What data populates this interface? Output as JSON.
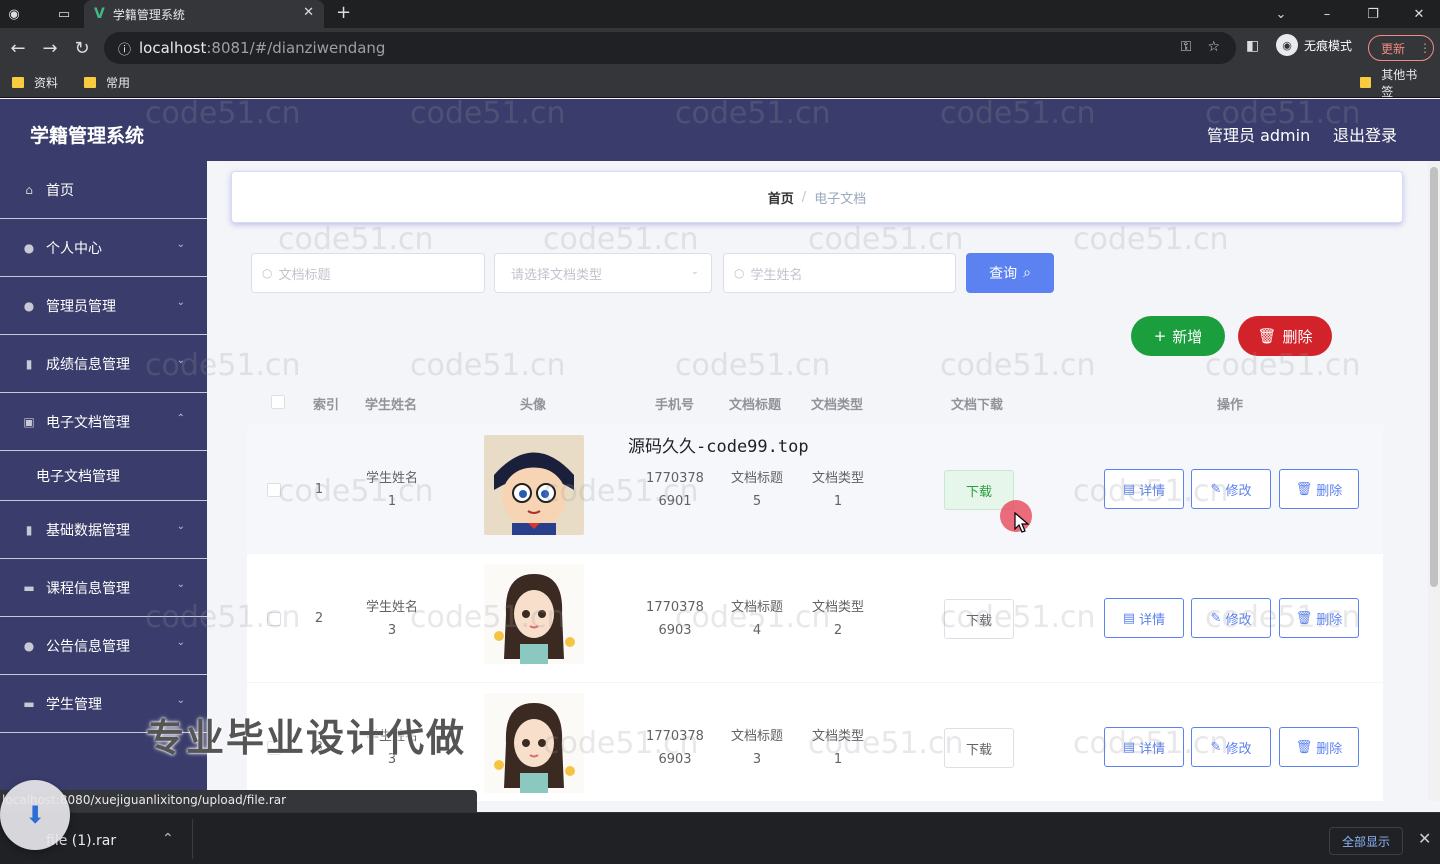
{
  "browser": {
    "tab_title": "学籍管理系统",
    "tab_logo": "V",
    "url_host": "localhost",
    "url_rest": ":8081/#/dianziwendang",
    "incognito_label": "无痕模式",
    "update_label": "更新",
    "bookmarks": [
      "资料",
      "常用"
    ],
    "other_bookmarks": "其他书签"
  },
  "header": {
    "brand": "学籍管理系统",
    "user": "管理员 admin",
    "logout": "退出登录"
  },
  "sidebar": {
    "items": [
      {
        "label": "首页",
        "icon": "home-icon"
      },
      {
        "label": "个人中心",
        "icon": "user-icon"
      },
      {
        "label": "管理员管理",
        "icon": "location-icon"
      },
      {
        "label": "成绩信息管理",
        "icon": "microphone-icon"
      },
      {
        "label": "电子文档管理",
        "icon": "delete-icon"
      },
      {
        "label": "电子文档管理",
        "icon": ""
      },
      {
        "label": "基础数据管理",
        "icon": "chart-icon"
      },
      {
        "label": "课程信息管理",
        "icon": "chat-icon"
      },
      {
        "label": "公告信息管理",
        "icon": "user-icon"
      },
      {
        "label": "学生管理",
        "icon": "briefcase-icon"
      }
    ]
  },
  "breadcrumb": {
    "home": "首页",
    "sep": "/",
    "current": "电子文档"
  },
  "search": {
    "title_placeholder": "文档标题",
    "type_placeholder": "请选择文档类型",
    "student_placeholder": "学生姓名",
    "query_label": "查询"
  },
  "actions": {
    "add_label": "新增",
    "delete_label": "删除"
  },
  "table": {
    "headers": [
      "索引",
      "学生姓名",
      "头像",
      "手机号",
      "文档标题",
      "文档类型",
      "文档下载",
      "操作"
    ],
    "rows": [
      {
        "index": "1",
        "name1": "学生姓名",
        "name2": "1",
        "phone1": "1770378",
        "phone2": "6901",
        "title1": "文档标题",
        "title2": "5",
        "type1": "文档类型",
        "type2": "1",
        "download": "下载"
      },
      {
        "index": "2",
        "name1": "学生姓名",
        "name2": "3",
        "phone1": "1770378",
        "phone2": "6903",
        "title1": "文档标题",
        "title2": "4",
        "type1": "文档类型",
        "type2": "2",
        "download": "下载"
      },
      {
        "index": "3",
        "name1": "学生姓名",
        "name2": "3",
        "phone1": "1770378",
        "phone2": "6903",
        "title1": "文档标题",
        "title2": "3",
        "type1": "文档类型",
        "type2": "1",
        "download": "下载"
      }
    ],
    "op_detail": "详情",
    "op_edit": "修改",
    "op_delete": "删除"
  },
  "overlay": {
    "source_text": "源码久久-code99.top",
    "ad_text": "专业毕业设计代做",
    "watermark": "code51.cn"
  },
  "status_url": "localhost:8080/xuejiguanlixitong/upload/file.rar",
  "downloads": {
    "file": "file (1).rar",
    "show_all": "全部显示"
  },
  "colors": {
    "header_bg": "#3a3d6b",
    "primary": "#5b82f0",
    "success": "#1a9e3e",
    "danger": "#d3232a"
  }
}
